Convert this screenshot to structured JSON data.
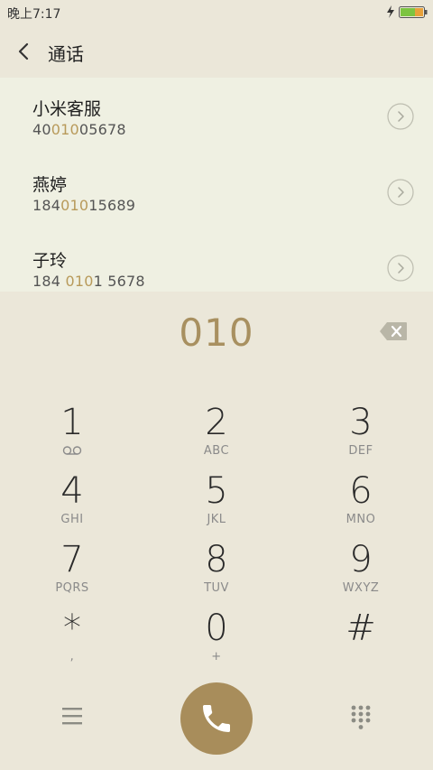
{
  "status_bar": {
    "time": "晚上7:17"
  },
  "header": {
    "title": "通话"
  },
  "matches": [
    {
      "name": "小米客服",
      "number_pre": "40",
      "number_hl": "010",
      "number_post": "05678"
    },
    {
      "name": "燕婷",
      "number_pre": "184",
      "number_hl": "010",
      "number_post": "15689"
    },
    {
      "name": "子玲",
      "number_pre": "184 ",
      "number_hl": "010",
      "number_post": "1 5678"
    }
  ],
  "dial_input": "010",
  "keypad": [
    {
      "digit": "1",
      "letters": ""
    },
    {
      "digit": "2",
      "letters": "ABC"
    },
    {
      "digit": "3",
      "letters": "DEF"
    },
    {
      "digit": "4",
      "letters": "GHI"
    },
    {
      "digit": "5",
      "letters": "JKL"
    },
    {
      "digit": "6",
      "letters": "MNO"
    },
    {
      "digit": "7",
      "letters": "PQRS"
    },
    {
      "digit": "8",
      "letters": "TUV"
    },
    {
      "digit": "9",
      "letters": "WXYZ"
    },
    {
      "digit": "*",
      "letters": ","
    },
    {
      "digit": "0",
      "letters": "+"
    },
    {
      "digit": "#",
      "letters": ""
    }
  ],
  "colors": {
    "accent": "#a88d5b",
    "highlight": "#b89a5a",
    "background": "#ebe7d9",
    "list_background": "#eff0e2"
  },
  "icons": [
    "back-icon",
    "detail-icon",
    "delete-icon",
    "voicemail-icon",
    "menu-icon",
    "phone-icon",
    "dialpad-icon",
    "battery-icon",
    "charge-icon"
  ]
}
